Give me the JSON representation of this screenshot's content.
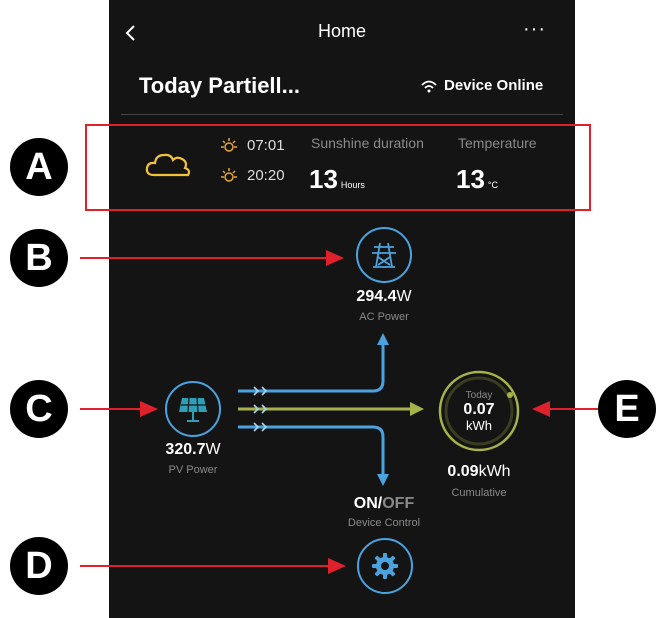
{
  "header": {
    "title": "Home",
    "back_icon": "chevron-left-icon",
    "more_label": "···"
  },
  "status": {
    "today_label": "Today",
    "weather_summary": "Partiell...",
    "device_status": "Device Online"
  },
  "weather": {
    "sunrise": "07:01",
    "sunset": "20:20",
    "sunshine_label": "Sunshine duration",
    "sunshine_value": "13",
    "sunshine_unit": "Hours",
    "temperature_label": "Temperature",
    "temperature_value": "13",
    "temperature_unit": "°C"
  },
  "flow": {
    "ac_value": "294.4",
    "ac_unit": "W",
    "ac_label": "AC Power",
    "pv_value": "320.7",
    "pv_unit": "W",
    "pv_label": "PV Power",
    "today_label": "Today",
    "today_value": "0.07",
    "today_unit": "kWh",
    "cumulative_value": "0.09",
    "cumulative_unit": "kWh",
    "cumulative_label": "Cumulative",
    "on_label": "ON",
    "slash": "/",
    "off_label": "OFF",
    "device_control_label": "Device Control"
  },
  "annotations": {
    "a": "A",
    "b": "B",
    "c": "C",
    "d": "D",
    "e": "E"
  },
  "colors": {
    "background": "#141414",
    "accent_blue": "#4aa3df",
    "accent_green": "#a7b24a",
    "cloud_yellow": "#f2c23a",
    "annotation_red": "#e0202a"
  }
}
